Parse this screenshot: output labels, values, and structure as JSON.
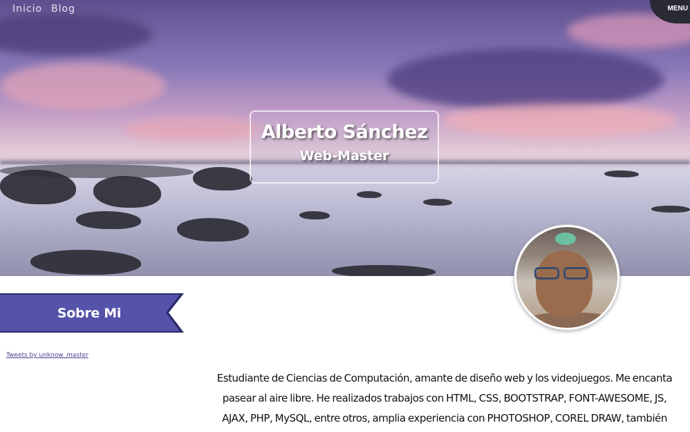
{
  "nav": {
    "items": [
      "Inicio",
      "Blog"
    ],
    "menu_label": "MENU"
  },
  "hero": {
    "name": "Alberto Sánchez",
    "role": "Web-Master"
  },
  "section": {
    "title": "Sobre Mi"
  },
  "twitter": {
    "link_text": "Tweets by unknow_master"
  },
  "about": {
    "text": "Estudiante de Ciencias de Computación, amante de diseño web y los videojuegos. Me encanta pasear al aire libre. He realizados trabajos con HTML, CSS, BOOTSTRAP, FONT-AWESOME, JS, AJAX, PHP, MySQL, entre otros, amplia experiencia con PHOTOSHOP, COREL DRAW, también"
  },
  "colors": {
    "ribbon": "#5552a9",
    "ribbon_shadow": "#2c2a6a",
    "link": "#4c3f8f"
  }
}
